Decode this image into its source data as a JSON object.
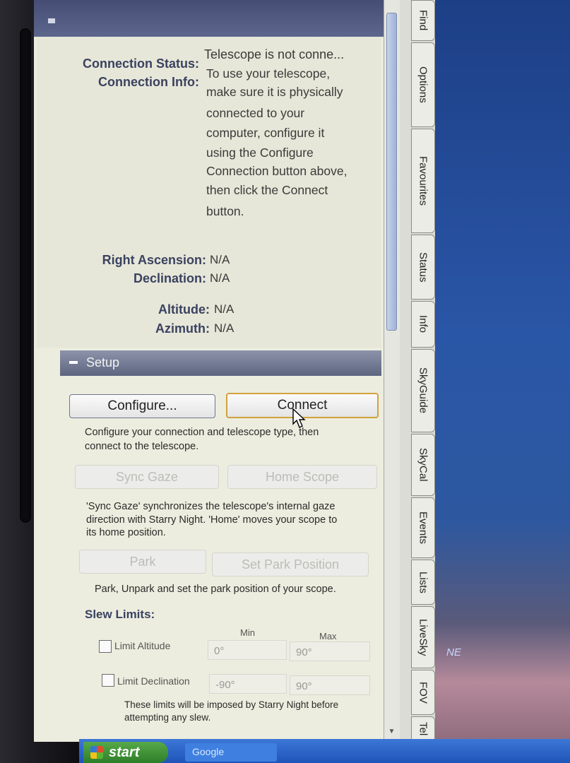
{
  "info": {
    "connection_status_label": "Connection Status:",
    "connection_status_value": "Telescope is not conne...",
    "connection_info_label": "Connection Info:",
    "connection_info_lines": [
      "To use your telescope,",
      "make sure it is physically",
      "connected to your",
      "computer, configure it",
      "using the Configure",
      "Connection button above,",
      "then click the Connect",
      "button."
    ],
    "ra_label": "Right Ascension:",
    "ra_value": "N/A",
    "dec_label": "Declination:",
    "dec_value": "N/A",
    "alt_label": "Altitude:",
    "alt_value": "N/A",
    "az_label": "Azimuth:",
    "az_value": "N/A"
  },
  "setup": {
    "title": "Setup",
    "configure_label": "Configure...",
    "connect_label": "Connect",
    "connect_desc_lines": [
      "Configure your connection and telescope type, then",
      "connect to the telescope."
    ],
    "sync_gaze_label": "Sync Gaze",
    "home_scope_label": "Home Scope",
    "sync_desc_lines": [
      "'Sync Gaze' synchronizes the telescope's internal gaze",
      "direction with Starry Night. 'Home' moves your scope to",
      "its home position."
    ],
    "park_label": "Park",
    "set_park_label": "Set Park Position",
    "park_desc": "Park, Unpark and set the park position of your scope."
  },
  "slew": {
    "title": "Slew Limits:",
    "min_header": "Min",
    "max_header": "Max",
    "limit_altitude_label": "Limit Altitude",
    "altitude_min": "0°",
    "altitude_max": "90°",
    "limit_declination_label": "Limit Declination",
    "declination_min": "-90°",
    "declination_max": "90°",
    "note_lines": [
      "These limits will be imposed by Starry Night before",
      "attempting any slew."
    ]
  },
  "tabs": [
    "Find",
    "Options",
    "Favourites",
    "Status",
    "Info",
    "SkyGuide",
    "SkyCal",
    "Events",
    "Lists",
    "LiveSky",
    "FOV",
    "Tel"
  ],
  "desktop_label": "NE",
  "taskbar": {
    "start_label": "start",
    "item_label": "Google"
  }
}
